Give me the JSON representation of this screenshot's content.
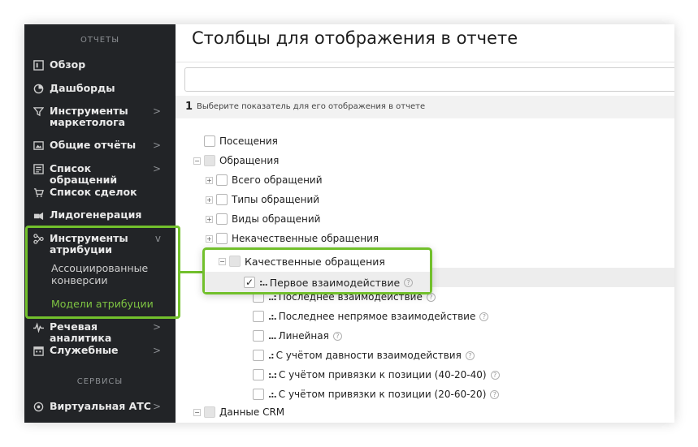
{
  "sidebar": {
    "section_reports": "ОТЧЕТЫ",
    "section_services": "СЕРВИСЫ",
    "items": [
      {
        "label": "Обзор",
        "icon": "overview-icon"
      },
      {
        "label": "Дашборды",
        "icon": "pie-chart-icon"
      },
      {
        "label": "Инструменты маркетолога",
        "icon": "funnel-icon",
        "arrow": ">"
      },
      {
        "label": "Общие отчёты",
        "icon": "image-icon",
        "arrow": ">"
      },
      {
        "label": "Список обращений",
        "icon": "list-icon",
        "arrow": ">"
      },
      {
        "label": "Список сделок",
        "icon": "cart-icon"
      },
      {
        "label": "Лидогенерация",
        "icon": "leadgen-icon"
      },
      {
        "label": "Инструменты атрибуции",
        "icon": "attribution-icon",
        "arrow": "v"
      },
      {
        "label": "Речевая аналитика",
        "icon": "wave-icon",
        "arrow": ">"
      },
      {
        "label": "Служебные",
        "icon": "calendar-icon",
        "arrow": ">"
      },
      {
        "label": "Виртуальная АТС",
        "icon": "globe-icon",
        "arrow": ">"
      }
    ],
    "attribution_sub": [
      {
        "label": "Ассоциированные конверсии"
      },
      {
        "label": "Модели атрибуции"
      }
    ]
  },
  "main": {
    "title": "Столбцы для отображения в отчете",
    "search_placeholder": "",
    "step_number": "1",
    "step_text": "Выберите показатель для его отображения в отчете",
    "tree": {
      "visits": "Посещения",
      "requests": "Обращения",
      "total_requests": "Всего обращений",
      "request_types": "Типы обращений",
      "request_kinds": "Виды обращений",
      "nonquality": "Некачественные обращения",
      "quality": "Качественные обращения",
      "first_touch": "Первое взаимодействие",
      "last_touch": "Последнее взаимодействие",
      "last_indirect": "Последнее непрямое взаимодействие",
      "linear": "Линейная",
      "time_decay": "С учётом давности взаимодействия",
      "position_40": "С учётом привязки к позиции (40-20-40)",
      "position_20": "С учётом привязки к позиции (20-60-20)",
      "crm_data": "Данные CRM",
      "dots_first": ":..",
      "dots_last": "..:",
      "dots_indirect": ".:.",
      "dots_linear": "...",
      "dots_decay": ".:",
      "dots_pos40": ":.:",
      "dots_pos20": ".:.",
      "check_mark": "✓",
      "plus": "+",
      "minus": "−",
      "help": "?"
    }
  },
  "colors": {
    "sidebar_bg": "#222427",
    "accent_green": "#72c02c",
    "active_sub": "#7ec442"
  }
}
